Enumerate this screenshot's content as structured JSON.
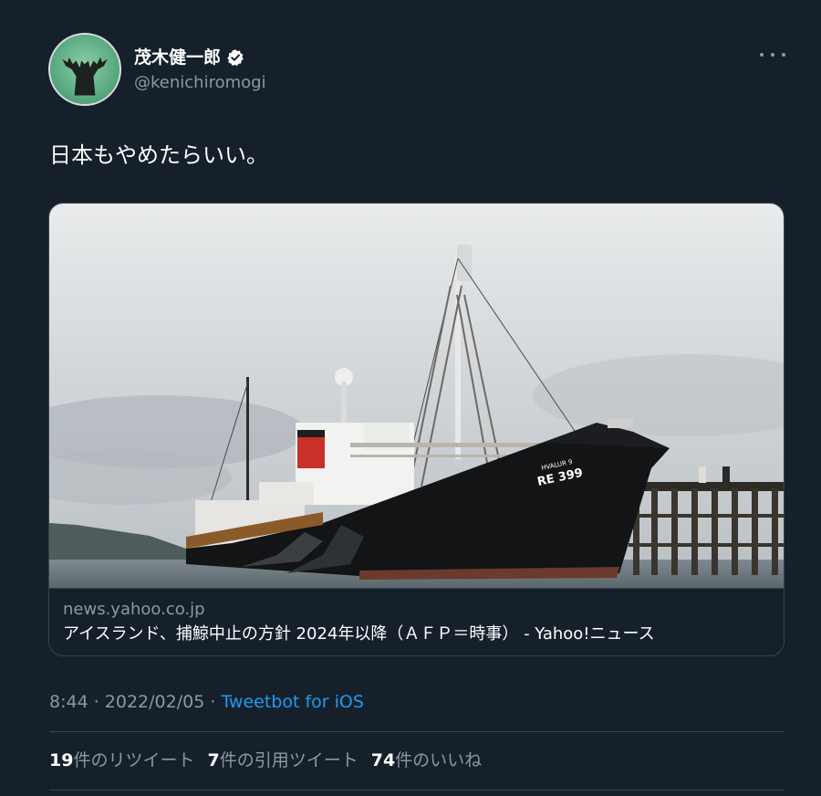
{
  "author": {
    "display_name": "茂木健一郎",
    "handle": "@kenichiromogi",
    "verified": true,
    "avatar_icon": "avatar-icon"
  },
  "tweet": {
    "text": "日本もやめたらいい。"
  },
  "card": {
    "domain": "news.yahoo.co.jp",
    "title": "アイスランド、捕鯨中止の方針 2024年以降（ＡＦＰ＝時事） - Yahoo!ニュース",
    "image_ship_name": "HVALUR 9",
    "image_ship_number": "RE 399"
  },
  "meta": {
    "time": "8:44",
    "date": "2022/02/05",
    "separator": " · ",
    "source": "Tweetbot for iOS"
  },
  "stats": {
    "retweets_count": "19",
    "retweets_label": "件のリツイート",
    "quotes_count": "7",
    "quotes_label": "件の引用ツイート",
    "likes_count": "74",
    "likes_label": "件のいいね"
  },
  "colors": {
    "background": "#15202b",
    "border": "#38444d",
    "secondary_text": "#8b98a5",
    "link": "#1d9bf0"
  }
}
